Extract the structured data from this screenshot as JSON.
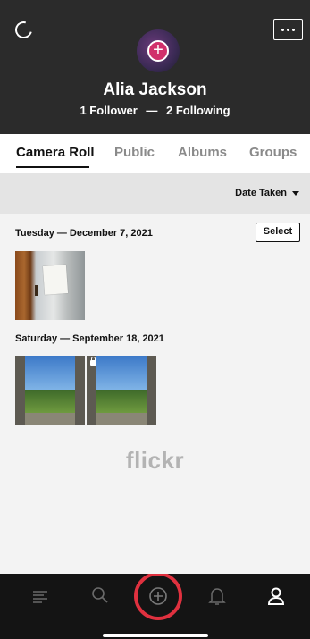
{
  "profile": {
    "name": "Alia Jackson",
    "followers": "1 Follower",
    "separator": "—",
    "following": "2 Following"
  },
  "tabs": [
    {
      "label": "Camera Roll",
      "active": true
    },
    {
      "label": "Public",
      "active": false
    },
    {
      "label": "Albums",
      "active": false
    },
    {
      "label": "Groups",
      "active": false
    }
  ],
  "sort": {
    "label": "Date Taken",
    "icon": "caret-down-icon"
  },
  "groups": [
    {
      "date": "Tuesday — December 7, 2021",
      "select_label": "Select",
      "photos": 1
    },
    {
      "date": "Saturday — September 18, 2021",
      "photos": 2
    }
  ],
  "watermark": "flickr",
  "header_icons": {
    "refresh": "refresh-icon",
    "more": "more-icon"
  },
  "bottom_nav": [
    "menu-icon",
    "search-icon",
    "add-photo-icon",
    "notifications-icon",
    "profile-icon"
  ],
  "colors": {
    "header": "#2b2b2b",
    "highlight_ring": "#e0313f",
    "tabbar": "#141414"
  }
}
